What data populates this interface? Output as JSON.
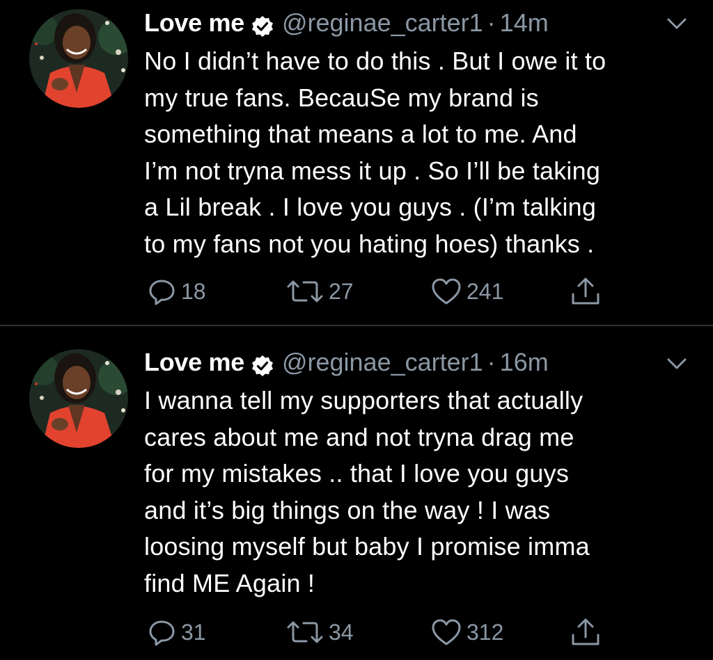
{
  "colors": {
    "background": "#000000",
    "text": "#ffffff",
    "muted": "#8b98a5",
    "divider": "#2f3336"
  },
  "tweets": [
    {
      "author": {
        "name": "Love me",
        "handle": "@reginae_carter1",
        "verified": true,
        "avatar": "profile-photo"
      },
      "separator": "·",
      "time": "14m",
      "text": "No I didn’t have to do this . But I owe it to\nmy true fans. BecauSe my brand is\nsomething that means a lot to me. And\nI’m not tryna mess it up . So I’ll be taking\na Lil break . I love you guys . (I’m talking\nto my fans not you hating hoes) thanks .",
      "stats": {
        "replies": "18",
        "retweets": "27",
        "likes": "241"
      },
      "icons": [
        "reply-icon",
        "retweet-icon",
        "like-icon",
        "share-icon",
        "chevron-down-icon",
        "verified-badge-icon"
      ]
    },
    {
      "author": {
        "name": "Love me",
        "handle": "@reginae_carter1",
        "verified": true,
        "avatar": "profile-photo"
      },
      "separator": "·",
      "time": "16m",
      "text": "I wanna tell my supporters that actually\ncares about me and not tryna drag me\nfor my mistakes .. that I love you guys\nand it’s big things on the way ! I was\nloosing myself but baby I promise imma\nfind ME Again !",
      "stats": {
        "replies": "31",
        "retweets": "34",
        "likes": "312"
      },
      "icons": [
        "reply-icon",
        "retweet-icon",
        "like-icon",
        "share-icon",
        "chevron-down-icon",
        "verified-badge-icon"
      ]
    }
  ]
}
